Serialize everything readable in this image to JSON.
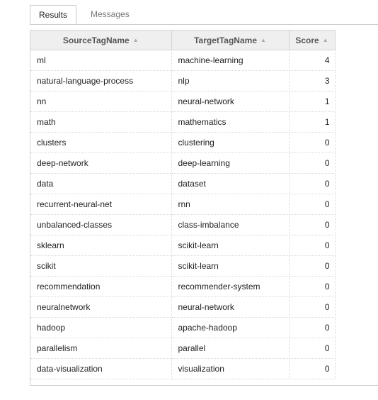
{
  "tabs": [
    {
      "label": "Results",
      "active": true
    },
    {
      "label": "Messages",
      "active": false
    }
  ],
  "grid": {
    "columns": [
      "SourceTagName",
      "TargetTagName",
      "Score"
    ],
    "sort_indicator": "▲",
    "rows": [
      [
        "ml",
        "machine-learning",
        "4"
      ],
      [
        "natural-language-process",
        "nlp",
        "3"
      ],
      [
        "nn",
        "neural-network",
        "1"
      ],
      [
        "math",
        "mathematics",
        "1"
      ],
      [
        "clusters",
        "clustering",
        "0"
      ],
      [
        "deep-network",
        "deep-learning",
        "0"
      ],
      [
        "data",
        "dataset",
        "0"
      ],
      [
        "recurrent-neural-net",
        "rnn",
        "0"
      ],
      [
        "unbalanced-classes",
        "class-imbalance",
        "0"
      ],
      [
        "sklearn",
        "scikit-learn",
        "0"
      ],
      [
        "scikit",
        "scikit-learn",
        "0"
      ],
      [
        "recommendation",
        "recommender-system",
        "0"
      ],
      [
        "neuralnetwork",
        "neural-network",
        "0"
      ],
      [
        "hadoop",
        "apache-hadoop",
        "0"
      ],
      [
        "parallelism",
        "parallel",
        "0"
      ],
      [
        "data-visualization",
        "visualization",
        "0"
      ]
    ]
  }
}
